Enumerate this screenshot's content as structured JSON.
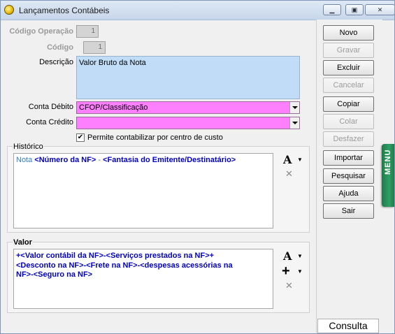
{
  "window": {
    "title": "Lançamentos Contábeis"
  },
  "form": {
    "codigo_operacao_label": "Código Operação",
    "codigo_operacao_value": "1",
    "codigo_label": "Código",
    "codigo_value": "1",
    "descricao_label": "Descrição",
    "descricao_value": "Valor Bruto da Nota",
    "conta_debito_label": "Conta Débito",
    "conta_debito_value": "CFOP/Classificação",
    "conta_credito_label": "Conta Crédito",
    "conta_credito_value": "",
    "centro_custo_label": "Permite contabilizar por centro de custo",
    "centro_custo_checked": true
  },
  "historico": {
    "title": "Histórico",
    "text_plain": "Nota",
    "text_sep1": " ",
    "token1": "<Número da NF>",
    "text_sep2": " - ",
    "token2": "<Fantasia do Emitente/Destinatário>"
  },
  "valor": {
    "title": "Valor",
    "line1": "+<Valor contábil da NF>-<Serviços prestados na NF>+",
    "line2": "<Desconto na NF>-<Frete na NF>-<despesas acessórias  na",
    "line3": "NF>-<Seguro na NF>"
  },
  "buttons": {
    "novo": "Novo",
    "gravar": "Gravar",
    "excluir": "Excluir",
    "cancelar": "Cancelar",
    "copiar": "Copiar",
    "colar": "Colar",
    "desfazer": "Desfazer",
    "importar": "Importar",
    "pesquisar": "Pesquisar",
    "ajuda": "Ajuda",
    "sair": "Sair"
  },
  "status": {
    "mode": "Consulta"
  },
  "menu_tab": {
    "label": "MENU"
  },
  "icons": {
    "font": "font-icon",
    "insert": "plus-icon",
    "clear": "clear-icon",
    "app": "app-icon"
  }
}
